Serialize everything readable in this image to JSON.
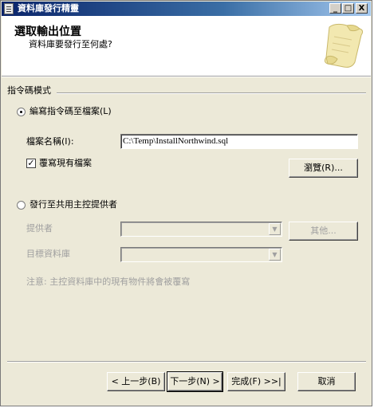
{
  "window": {
    "title": "資料庫發行精靈",
    "controls": {
      "minimize": "_",
      "maximize": "□",
      "close": "X"
    }
  },
  "header": {
    "title": "選取輸出位置",
    "subtitle": "資料庫要發行至何處?",
    "art_icon": "scroll-icon"
  },
  "script_mode": {
    "group_label": "指令碼模式",
    "write_to_file": {
      "label": "編寫指令碼至檔案(L)",
      "selected": true,
      "filename_label": "檔案名稱(I):",
      "filename_value": "C:\\Temp\\InstallNorthwind.sql",
      "overwrite_label": "覆寫現有檔案",
      "overwrite_checked": true,
      "browse_label": "瀏覽(R)..."
    },
    "publish_to_host": {
      "label": "發行至共用主控提供者",
      "selected": false,
      "provider_label": "提供者",
      "provider_value": "",
      "other_label": "其他...",
      "target_db_label": "目標資料庫",
      "target_db_value": "",
      "note": "注意: 主控資料庫中的現有物件將會被覆寫"
    }
  },
  "footer": {
    "back": "< 上一步(B)",
    "next": "下一步(N) >",
    "finish": "完成(F) >>|",
    "cancel": "取消"
  }
}
